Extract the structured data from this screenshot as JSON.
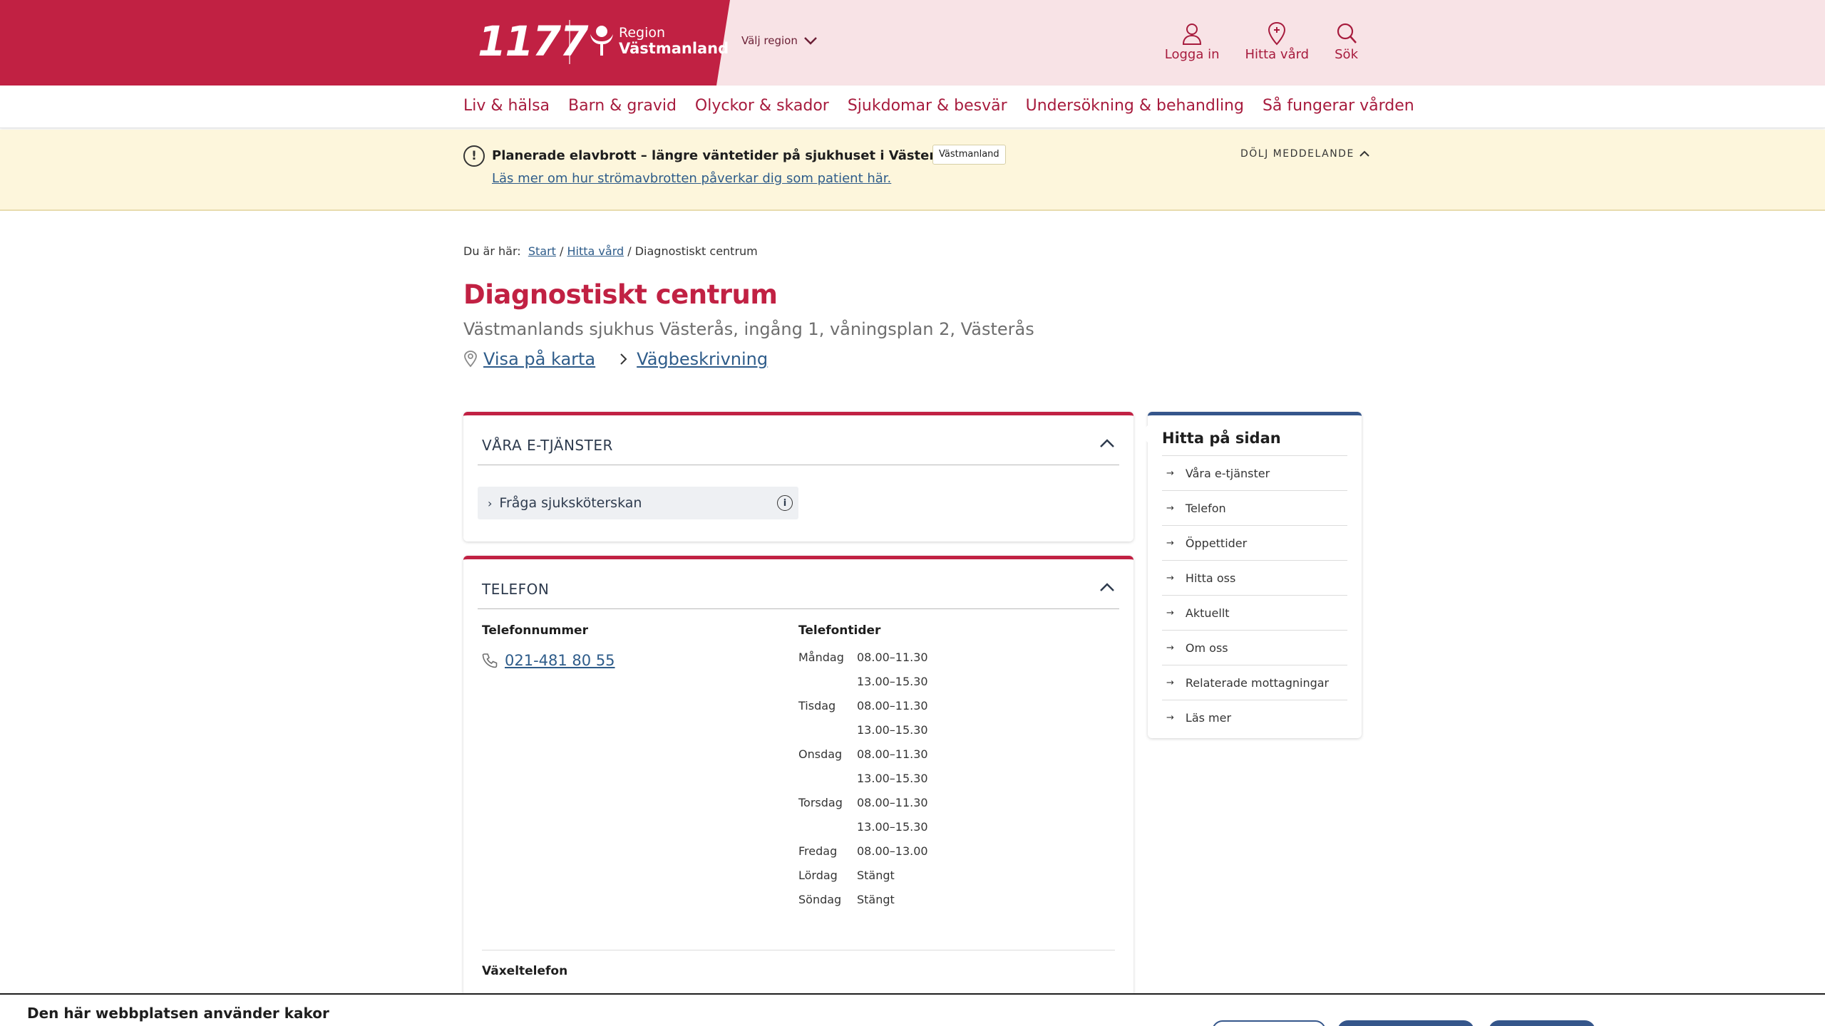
{
  "header": {
    "logo_text": "1177",
    "region_small": "Region",
    "region_name": "Västmanland",
    "choose_region": "Välj region",
    "actions": [
      {
        "label": "Logga in",
        "icon": "user-icon"
      },
      {
        "label": "Hitta vård",
        "icon": "map-pin-icon"
      },
      {
        "label": "Sök",
        "icon": "search-icon"
      }
    ]
  },
  "nav": {
    "items": [
      "Liv & hälsa",
      "Barn & gravid",
      "Olyckor & skador",
      "Sjukdomar & besvär",
      "Undersökning & behandling",
      "Så fungerar vården"
    ]
  },
  "alert": {
    "title": "Planerade elavbrott – längre väntetider på sjukhuset i Västerås 31 maj",
    "badge": "Västmanland",
    "link": "Läs mer om hur strömavbrotten påverkar dig som patient här.",
    "dismiss": "DÖLJ MEDDELANDE"
  },
  "breadcrumb": {
    "prefix": "Du är här:",
    "start": "Start",
    "hitta_vard": "Hitta vård",
    "current": "Diagnostiskt centrum"
  },
  "page": {
    "title": "Diagnostiskt centrum",
    "subtitle": "Västmanlands sjukhus Västerås, ingång 1, våningsplan 2, Västerås",
    "map_link": "Visa på karta",
    "directions_link": "Vägbeskrivning"
  },
  "eservices": {
    "title": "VÅRA E-TJÄNSTER",
    "button": "Fråga sjuksköterskan"
  },
  "telefon": {
    "title": "TELEFON",
    "number_label": "Telefonnummer",
    "number": "021-481 80 55",
    "hours_label": "Telefontider",
    "hours": [
      {
        "day": "Måndag",
        "time": "08.00–11.30"
      },
      {
        "day": "",
        "time": "13.00–15.30"
      },
      {
        "day": "Tisdag",
        "time": "08.00–11.30"
      },
      {
        "day": "",
        "time": "13.00–15.30"
      },
      {
        "day": "Onsdag",
        "time": "08.00–11.30"
      },
      {
        "day": "",
        "time": "13.00–15.30"
      },
      {
        "day": "Torsdag",
        "time": "08.00–11.30"
      },
      {
        "day": "",
        "time": "13.00–15.30"
      },
      {
        "day": "Fredag",
        "time": "08.00–13.00"
      },
      {
        "day": "Lördag",
        "time": "Stängt"
      },
      {
        "day": "Söndag",
        "time": "Stängt"
      }
    ],
    "switchboard_label": "Växeltelefon"
  },
  "sidenav": {
    "title": "Hitta på sidan",
    "items": [
      "Våra e-tjänster",
      "Telefon",
      "Öppettider",
      "Hitta oss",
      "Aktuellt",
      "Om oss",
      "Relaterade mottagningar",
      "Läs mer"
    ]
  },
  "cookie": {
    "title": "Den här webbplatsen använder kakor"
  },
  "colors": {
    "brand_red": "#c12143",
    "header_pink": "#f8e3e6",
    "alert_yellow": "#fdf6dc",
    "link_blue": "#2e5c8a",
    "sidenav_blue": "#35568b"
  }
}
